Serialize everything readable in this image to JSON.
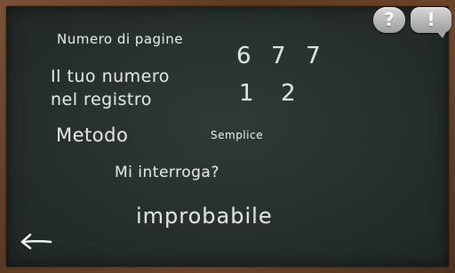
{
  "labels": {
    "pages": "Numero di pagine",
    "register_number_line1": "Il tuo numero",
    "register_number_line2": "nel registro",
    "method": "Metodo",
    "question": "Mi interroga?"
  },
  "values": {
    "pages_digits": [
      "6",
      "7",
      "7"
    ],
    "register_digits": [
      "1",
      "2"
    ],
    "method": "Semplice",
    "result": "improbabile"
  },
  "buttons": {
    "help": "?",
    "report": "!"
  },
  "icons": {
    "back": "back-arrow-icon"
  },
  "colors": {
    "chalk": "#ecefea",
    "board": "#28312d",
    "frame": "#5b3a22"
  }
}
